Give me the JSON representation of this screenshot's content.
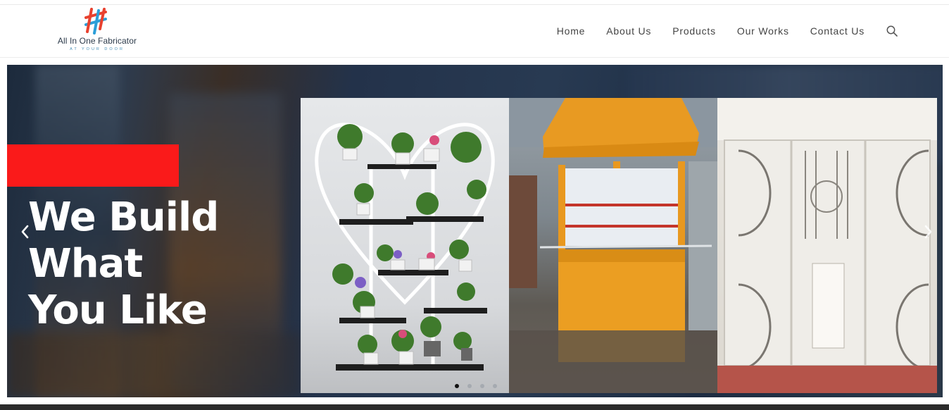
{
  "brand": {
    "name": "All In One Fabricator",
    "tagline": "AT YOUR DOOR",
    "colors": {
      "red": "#e8412f",
      "blue": "#2b9ed8"
    }
  },
  "nav": {
    "items": [
      "Home",
      "About Us",
      "Products",
      "Our Works",
      "Contact Us"
    ],
    "search_icon": "search-icon"
  },
  "slider": {
    "headline_line1": "We Build What",
    "headline_line2": "You Like",
    "accent_color": "#fa1a1a",
    "active_slide": 1,
    "slide_count": 4,
    "prev_icon": "chevron-left-icon",
    "next_icon": "chevron-right-icon"
  }
}
